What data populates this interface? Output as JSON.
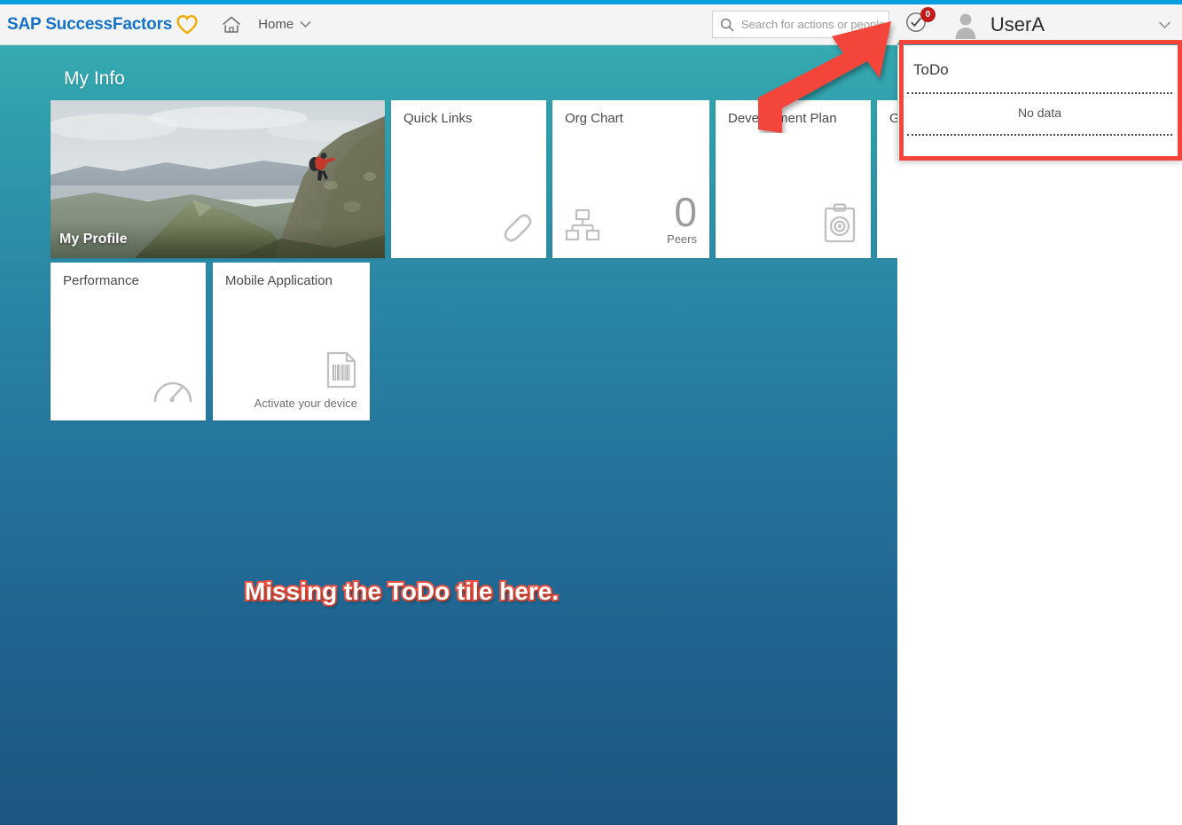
{
  "header": {
    "brand": "SAP SuccessFactors",
    "brand_icon": "heart-icon",
    "brand_color": "#1572c6",
    "heart_color": "#f0ab00",
    "home_icon": "home-icon",
    "nav_label": "Home",
    "nav_chevron": "chevron-down-icon",
    "search": {
      "icon": "search-icon",
      "placeholder": "Search for actions or people",
      "value": ""
    },
    "todo": {
      "icon": "circle-check-icon",
      "badge_count": "0",
      "badge_color": "#c21a1a"
    },
    "user": {
      "avatar_icon": "user-avatar-icon",
      "name": "UserA",
      "chevron": "chevron-down-icon"
    },
    "top_strip_color": "#009de0"
  },
  "main": {
    "section_title": "My Info",
    "background_top_color": "#35aab1",
    "background_bottom_color": "#1d5580",
    "tiles": [
      {
        "id": "my-profile",
        "title": "My Profile",
        "type": "photo",
        "photo_alt": "hiker climbing mountain ridge"
      },
      {
        "id": "quick-links",
        "title": "Quick Links",
        "icon": "chain-link-icon"
      },
      {
        "id": "org-chart",
        "title": "Org Chart",
        "icon": "org-hierarchy-icon",
        "value": "0",
        "value_label": "Peers"
      },
      {
        "id": "development-plan",
        "title": "Development Plan",
        "icon": "clipboard-target-icon"
      },
      {
        "id": "goals",
        "title": "G",
        "icon": ""
      },
      {
        "id": "performance",
        "title": "Performance",
        "icon": "speedometer-gauge-icon"
      },
      {
        "id": "mobile-application",
        "title": "Mobile Application",
        "icon": "barcode-document-icon",
        "caption": "Activate your device"
      }
    ]
  },
  "todo_popup": {
    "title": "ToDo",
    "empty_message": "No data",
    "accent_color": "#3a9aa8"
  },
  "annotations": {
    "callout_text": "Missing the ToDo tile here.",
    "callout_fill": "#ffffff",
    "callout_stroke": "#f4513f",
    "arrow_color": "#f4453a",
    "highlight_box_color": "#f4453a"
  }
}
